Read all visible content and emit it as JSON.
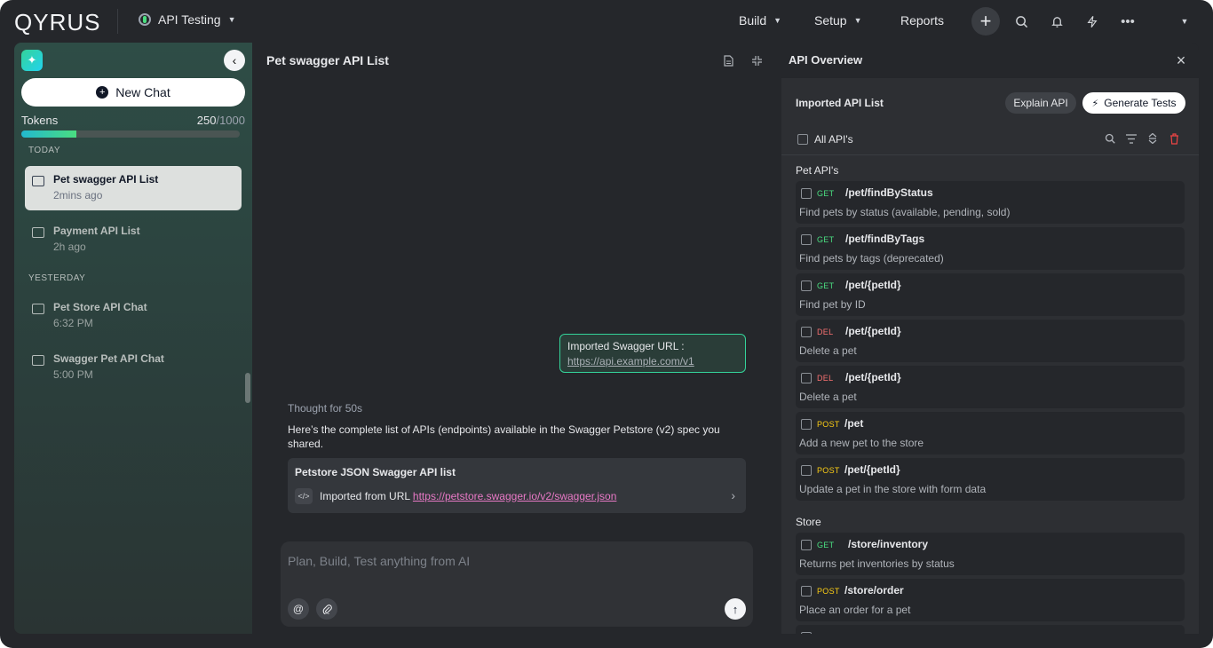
{
  "topbar": {
    "logo": "QYRUS",
    "app": "API Testing",
    "nav": [
      "Build",
      "Setup",
      "Reports"
    ]
  },
  "sidebar": {
    "new_chat": "New Chat",
    "tokens_label": "Tokens",
    "tokens_used": "250",
    "tokens_max": "/1000",
    "tokens_fraction": 0.25,
    "today_label": "TODAY",
    "yesterday_label": "YESTERDAY",
    "chats": [
      {
        "title": "Pet swagger API List",
        "time": "2mins ago"
      },
      {
        "title": "Payment API List",
        "time": "2h ago"
      },
      {
        "title": "Pet Store API Chat",
        "time": "6:32 PM"
      },
      {
        "title": "Swagger Pet API Chat",
        "time": "5:00 PM"
      }
    ]
  },
  "chat": {
    "title": "Pet swagger API List",
    "user_msg_label": "Imported Swagger URL :",
    "user_msg_url": "https://api.example.com/v1",
    "thought": "Thought for 50s",
    "answer": "Here’s the complete list of APIs (endpoints) available in the Swagger Petstore (v2) spec you shared.",
    "card_title": "Petstore JSON Swagger API list",
    "card_prefix": "Imported from URL ",
    "card_link": "https://petstore.swagger.io/v2/swagger.json",
    "placeholder": "Plan, Build, Test anything from AI"
  },
  "overview": {
    "title": "API Overview",
    "list_title": "Imported API List",
    "explain_btn": "Explain API",
    "generate_btn": "Generate Tests",
    "all_label": "All API's",
    "groups": [
      {
        "name": "Pet API's",
        "endpoints": [
          {
            "method": "GET",
            "path": "/pet/findByStatus",
            "desc": "Find pets by status (available, pending, sold)"
          },
          {
            "method": "GET",
            "path": "/pet/findByTags",
            "desc": "Find pets by tags (deprecated)"
          },
          {
            "method": "GET",
            "path": "/pet/{petId}",
            "desc": "Find pet by ID"
          },
          {
            "method": "DEL",
            "path": "/pet/{petId}",
            "desc": "Delete a pet"
          },
          {
            "method": "DEL",
            "path": "/pet/{petId}",
            "desc": "Delete a pet"
          },
          {
            "method": "POST",
            "path": "/pet",
            "desc": "Add a new pet to the store"
          },
          {
            "method": "POST",
            "path": "/pet/{petId}",
            "desc": "Update a pet in the store with form data"
          }
        ]
      },
      {
        "name": "Store",
        "endpoints": [
          {
            "method": "GET",
            "path": "/store/inventory",
            "desc": "Returns pet inventories by status"
          },
          {
            "method": "POST",
            "path": "/store/order",
            "desc": "Place an order for a pet"
          }
        ]
      }
    ],
    "colors": {
      "get": "#4ade80",
      "del": "#f87171",
      "post": "#facc15",
      "accent": "#34d399"
    }
  }
}
